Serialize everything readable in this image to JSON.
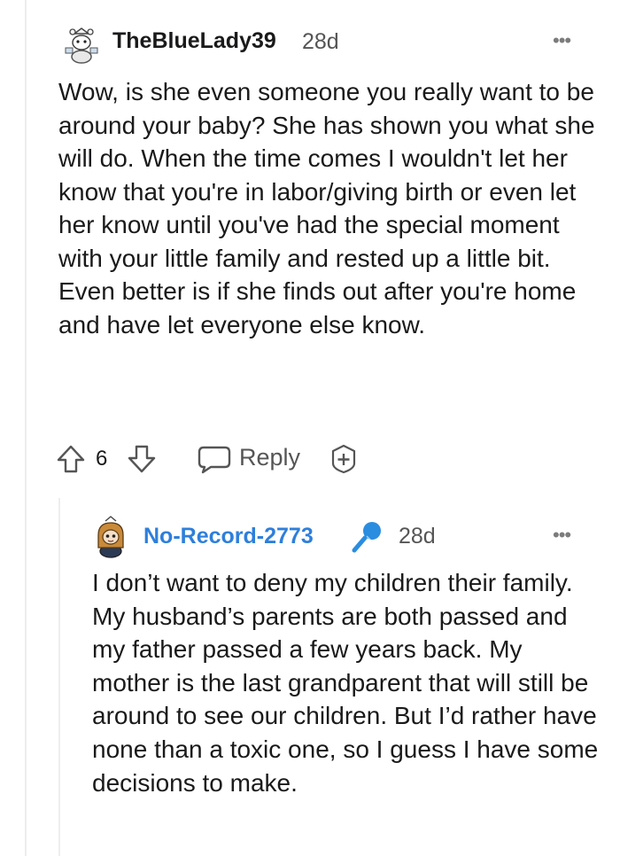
{
  "comment1": {
    "author": "TheBlueLady39",
    "age": "28d",
    "more_label": "•••",
    "avatar_icon": "snoo-avatar-icon",
    "body": "Wow, is she even someone you really want to be around your baby? She has shown you what she will do. When the time comes I wouldn't let her know that you're in labor/giving birth or even let her know until you've had the special moment with your little family and rested up a little bit. Even better is if she finds out after you're home and have let everyone else know.",
    "score": "6",
    "reply_label": "Reply",
    "icons": {
      "upvote": "upvote-arrow-icon",
      "downvote": "downvote-arrow-icon",
      "reply": "speech-bubble-icon",
      "award": "award-plus-icon"
    }
  },
  "comment2": {
    "author": "No-Record-2773",
    "author_color": "#2e7fdb",
    "op_icon": "microphone-icon",
    "age": "28d",
    "more_label": "•••",
    "avatar_icon": "snoo-avatar-icon",
    "body": "I don’t want to deny my children their family. My husband’s parents are both passed and my father passed a few years back. My mother is the last grandparent that will still be around to see our children. But I’d rather have none than a toxic one, so I guess I have some decisions to make."
  }
}
